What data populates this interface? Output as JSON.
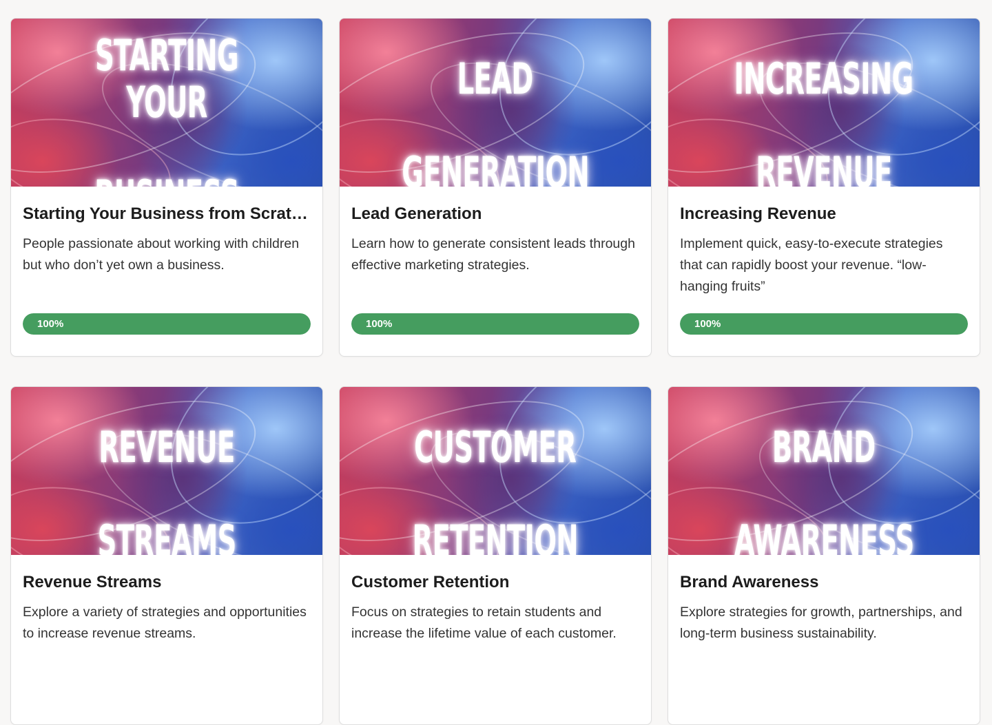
{
  "courses": [
    {
      "thumb_lines": [
        "STARTING YOUR",
        "BUSINESS"
      ],
      "title": "Starting Your Business from Scrat…",
      "description": "People passionate about working with children but who don’t yet own a business.",
      "progress_label": "100%",
      "progress": 1.0
    },
    {
      "thumb_lines": [
        "LEAD",
        "GENERATION"
      ],
      "title": "Lead Generation",
      "description": "Learn how to generate consistent leads through effective marketing strategies.",
      "progress_label": "100%",
      "progress": 1.0
    },
    {
      "thumb_lines": [
        "INCREASING",
        "REVENUE"
      ],
      "title": "Increasing Revenue",
      "description": "Implement quick, easy-to-execute strategies that can rapidly boost your revenue. “low-hanging fruits”",
      "progress_label": "100%",
      "progress": 1.0
    },
    {
      "thumb_lines": [
        "REVENUE",
        "STREAMS"
      ],
      "title": "Revenue Streams",
      "description": "Explore a variety of strategies and opportunities to increase revenue streams.",
      "progress_label": "",
      "progress": null
    },
    {
      "thumb_lines": [
        "CUSTOMER",
        "RETENTION"
      ],
      "title": "Customer Retention",
      "description": "Focus on strategies to retain students and increase the lifetime value of each customer.",
      "progress_label": "",
      "progress": null
    },
    {
      "thumb_lines": [
        "BRAND",
        "AWARENESS"
      ],
      "title": "Brand Awareness",
      "description": "Explore strategies for growth, partnerships, and long-term business sustainability.",
      "progress_label": "",
      "progress": null
    }
  ],
  "colors": {
    "progress_fill": "#459d5f",
    "card_bg": "#ffffff",
    "page_bg": "#f8f7f6"
  }
}
